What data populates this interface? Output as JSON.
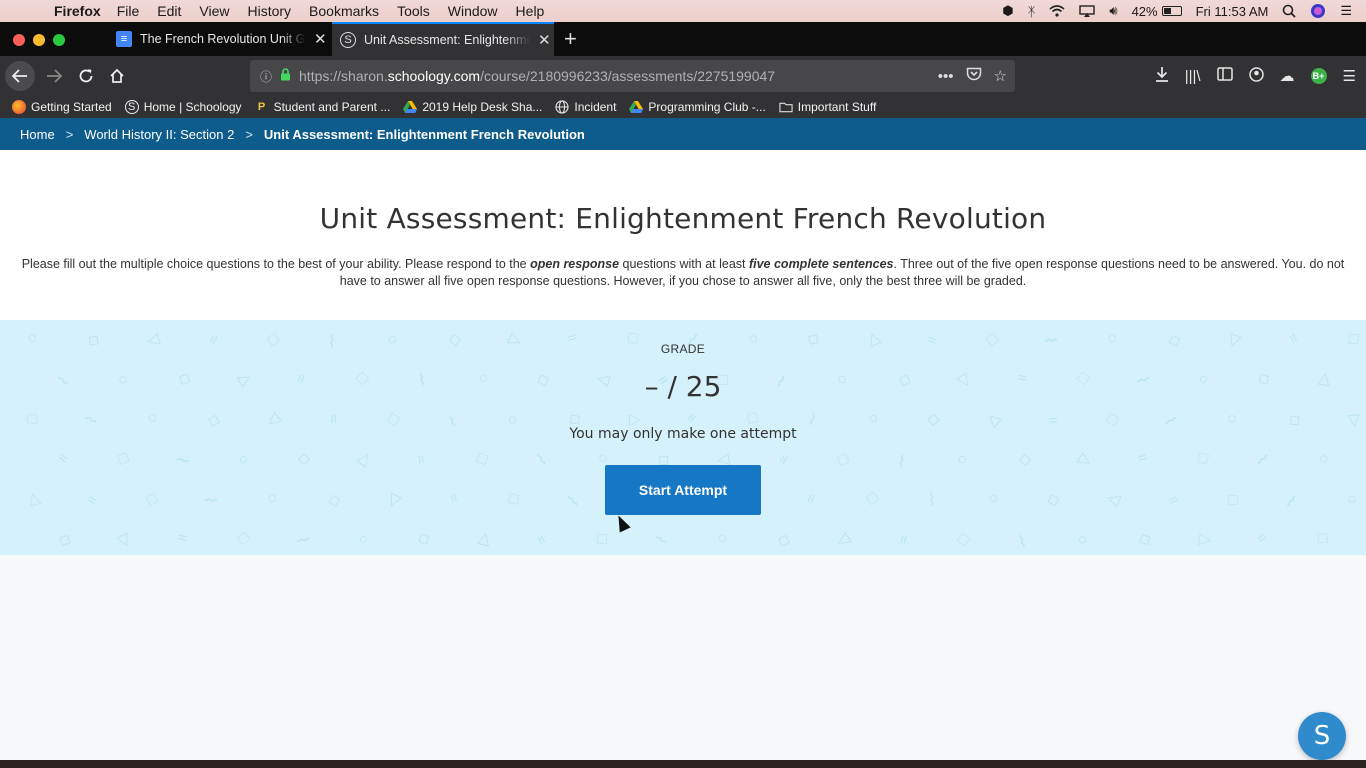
{
  "menubar": {
    "app": "Firefox",
    "items": [
      "File",
      "Edit",
      "View",
      "History",
      "Bookmarks",
      "Tools",
      "Window",
      "Help"
    ],
    "battery": "42%",
    "battery_level": 0.42,
    "clock": "Fri 11:53 AM"
  },
  "tabs": [
    {
      "title": "The French Revolution Unit Gui",
      "icon": "google-docs-icon",
      "active": false
    },
    {
      "title": "Unit Assessment: Enlightenmen",
      "icon": "schoology-icon",
      "active": true
    }
  ],
  "urlbar": {
    "prefix": "https://sharon.",
    "host": "schoology.com",
    "path": "/course/2180996233/assessments/2275199047"
  },
  "bookmarks": [
    {
      "label": "Getting Started",
      "icon": "firefox-icon"
    },
    {
      "label": "Home | Schoology",
      "icon": "schoology-icon"
    },
    {
      "label": "Student and Parent ...",
      "icon": "p-icon"
    },
    {
      "label": "2019 Help Desk Sha...",
      "icon": "google-drive-icon"
    },
    {
      "label": "Incident",
      "icon": "globe-icon"
    },
    {
      "label": "Programming Club -...",
      "icon": "google-drive-icon"
    },
    {
      "label": "Important Stuff",
      "icon": "folder-icon"
    }
  ],
  "breadcrumb": {
    "home": "Home",
    "course": "World History II: Section 2",
    "current": "Unit Assessment: Enlightenment French Revolution",
    "separator": ">"
  },
  "assessment": {
    "title": "Unit Assessment: Enlightenment French Revolution",
    "instructions": {
      "part1": "Please fill out the multiple choice questions to the best of your ability. Please respond to the ",
      "em1": "open response",
      "part2": " questions with at least ",
      "em2": "five complete sentences",
      "part3": ". Three out of the five open response questions need to be answered. You. do not have to answer all five open response questions. However, if you chose to answer all five, only the best three will be graded."
    },
    "grade_label": "GRADE",
    "grade_value": "– / 25",
    "attempt_note": "You may only make one attempt",
    "start_button": "Start Attempt"
  },
  "chat": {
    "letter": "S"
  },
  "colors": {
    "breadcrumb_bg": "#0d5c8c",
    "grade_panel_bg": "#d5f1fb",
    "button_bg": "#1677c5",
    "tab_active_accent": "#0a84ff"
  }
}
